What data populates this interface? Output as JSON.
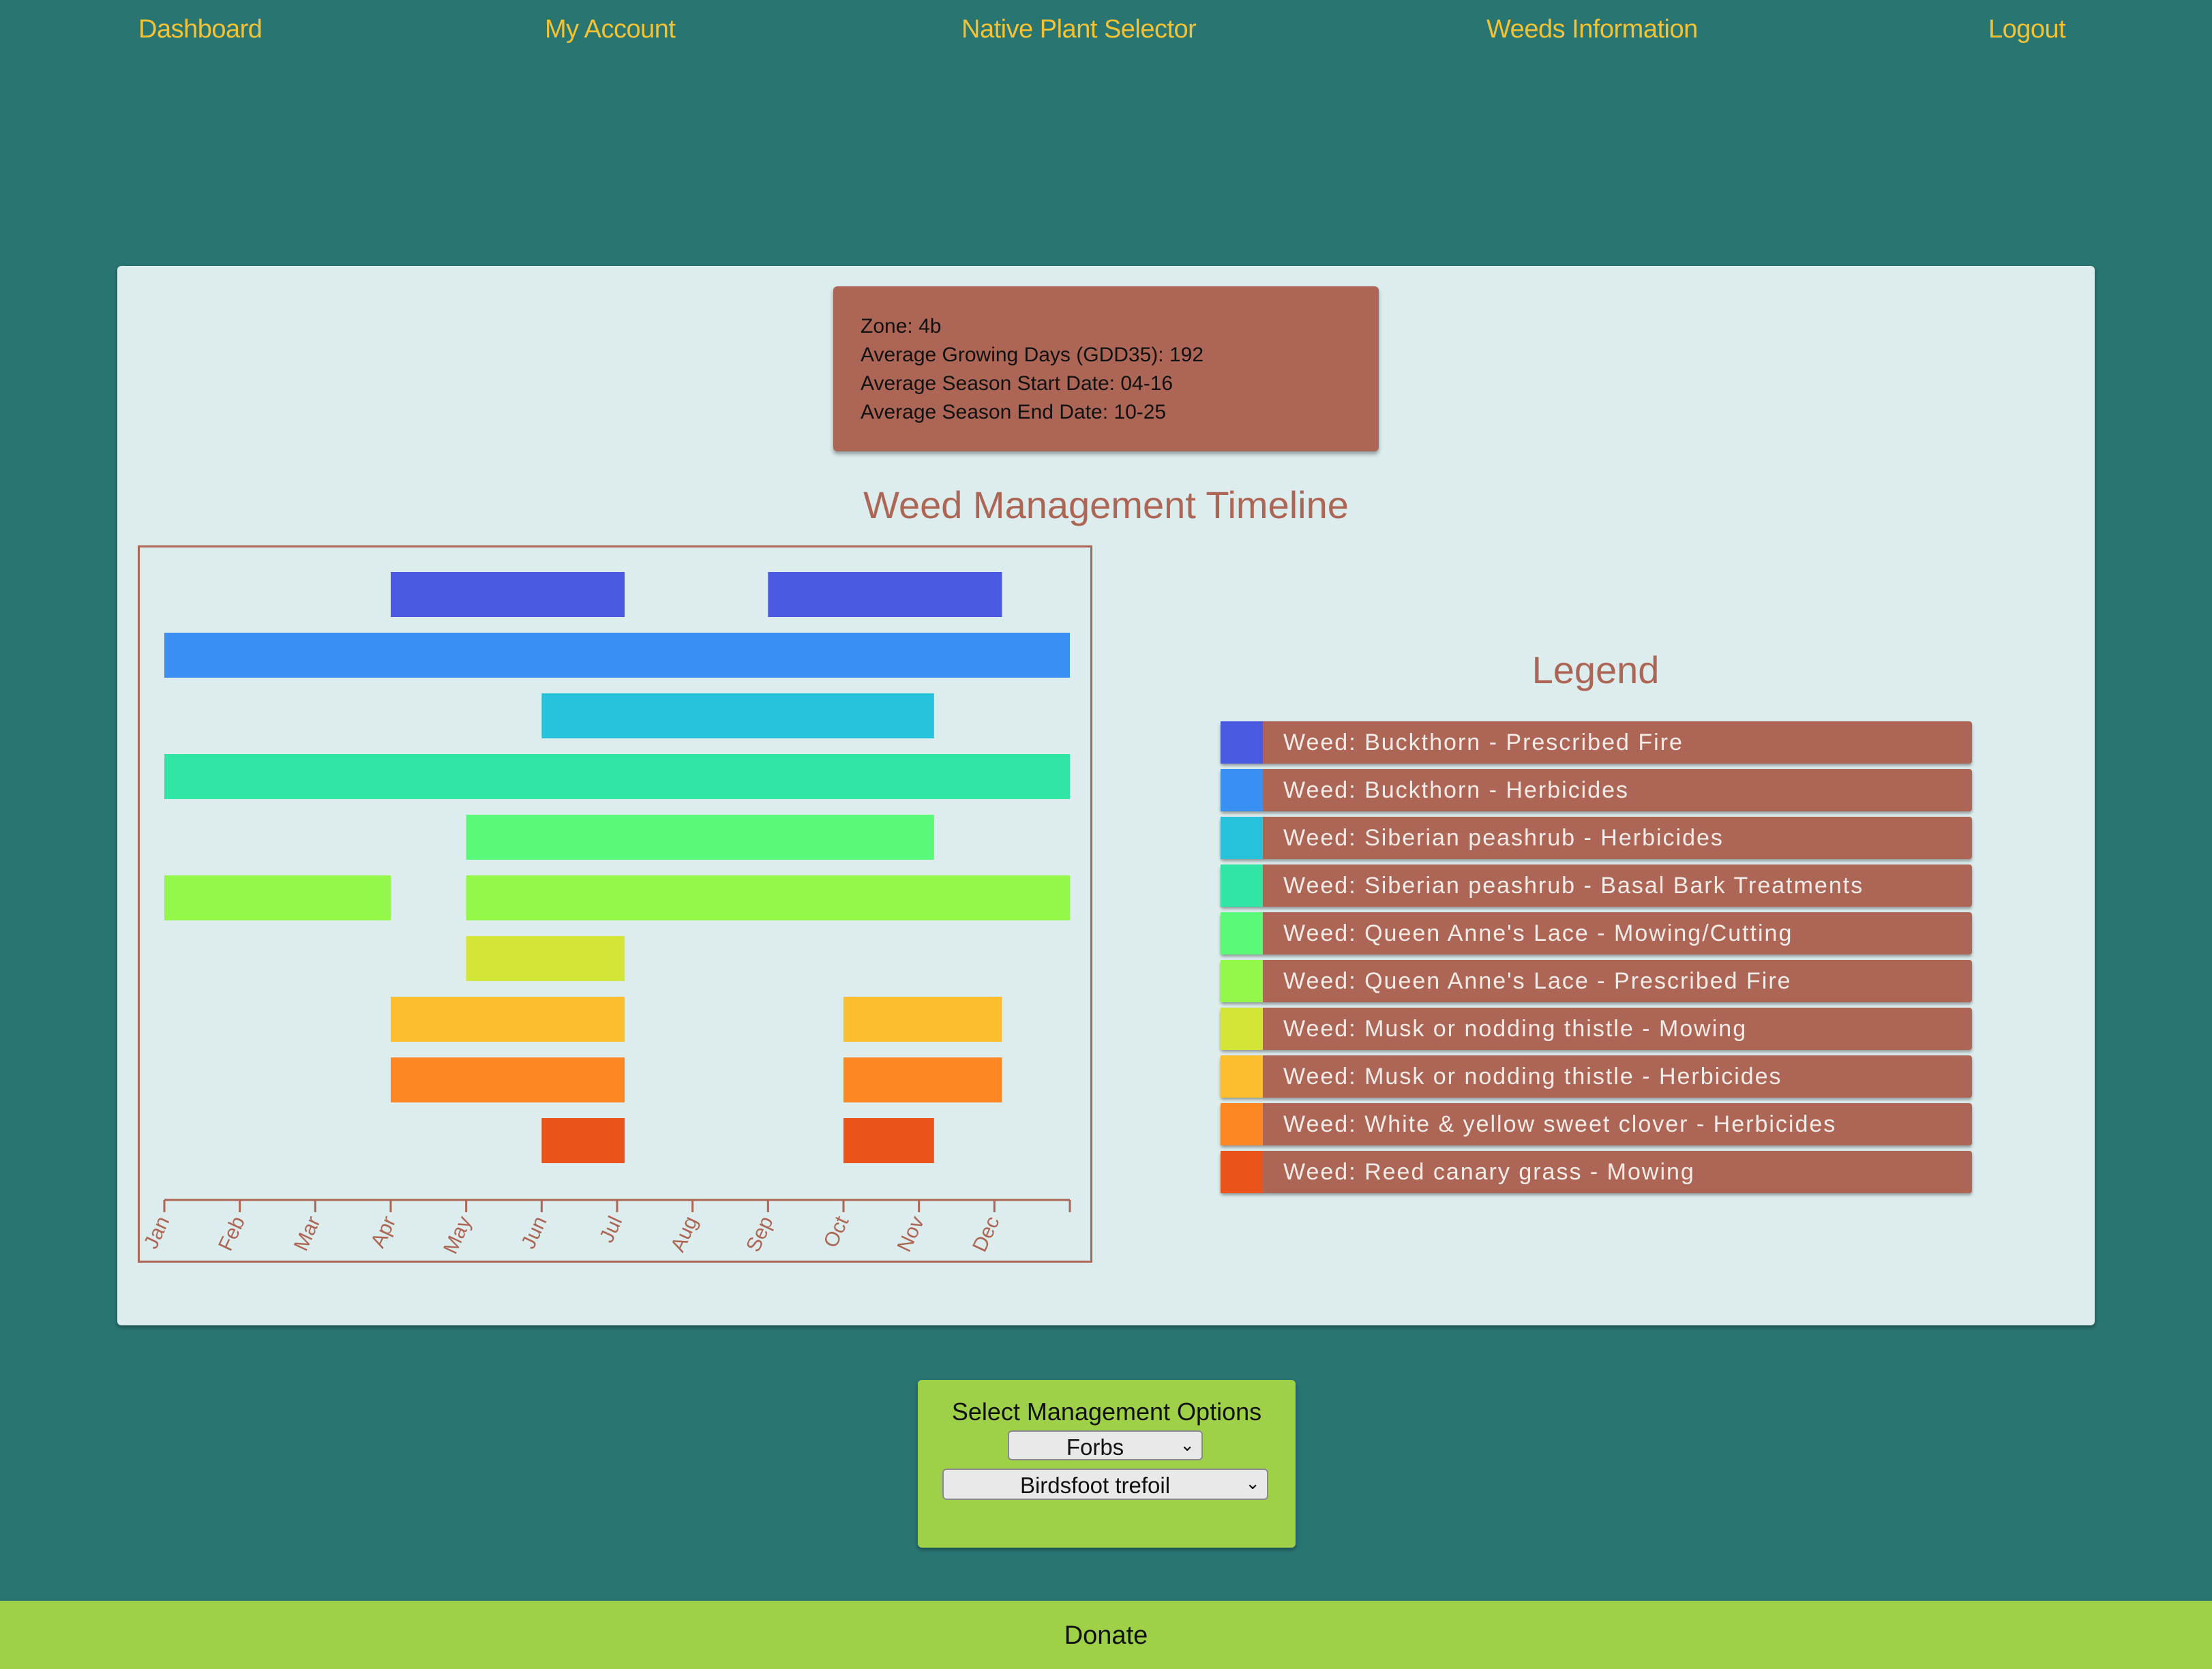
{
  "nav": {
    "dashboard": "Dashboard",
    "my_account": "My Account",
    "native_plant_selector": "Native Plant Selector",
    "weeds_information": "Weeds Information",
    "logout": "Logout"
  },
  "zone_info": {
    "zone_label": "Zone:",
    "zone_value": "4b",
    "gdd_label": "Average Growing Days (GDD35):",
    "gdd_value": "192",
    "start_label": "Average Season Start Date:",
    "start_value": "04-16",
    "end_label": "Average Season End Date:",
    "end_value": "10-25"
  },
  "timeline_title": "Weed Management Timeline",
  "legend_title": "Legend",
  "chart_data": {
    "type": "bar",
    "orientation": "horizontal-timeline",
    "months": [
      "Jan",
      "Feb",
      "Mar",
      "Apr",
      "May",
      "Jun",
      "Jul",
      "Aug",
      "Sep",
      "Oct",
      "Nov",
      "Dec"
    ],
    "series": [
      {
        "name": "Weed: Buckthorn - Prescribed Fire",
        "color": "#4a5ae0",
        "ranges": [
          [
            3.0,
            6.1
          ],
          [
            8.0,
            11.1
          ]
        ]
      },
      {
        "name": "Weed: Buckthorn - Herbicides",
        "color": "#3a8ff2",
        "ranges": [
          [
            0.0,
            12.0
          ]
        ]
      },
      {
        "name": "Weed: Siberian peashrub - Herbicides",
        "color": "#26c2db",
        "ranges": [
          [
            5.0,
            10.2
          ]
        ]
      },
      {
        "name": "Weed: Siberian peashrub - Basal Bark Treatments",
        "color": "#30e6a4",
        "ranges": [
          [
            0.0,
            12.0
          ]
        ]
      },
      {
        "name": "Weed: Queen Anne's Lace - Mowing/Cutting",
        "color": "#5afa78",
        "ranges": [
          [
            4.0,
            10.2
          ]
        ]
      },
      {
        "name": "Weed: Queen Anne's Lace - Prescribed Fire",
        "color": "#93f84a",
        "ranges": [
          [
            0.0,
            3.0
          ],
          [
            4.0,
            12.0
          ]
        ]
      },
      {
        "name": "Weed: Musk or nodding thistle - Mowing",
        "color": "#d3e638",
        "ranges": [
          [
            4.0,
            6.1
          ]
        ]
      },
      {
        "name": "Weed: Musk or nodding thistle - Herbicides",
        "color": "#fcbd2e",
        "ranges": [
          [
            3.0,
            6.1
          ],
          [
            9.0,
            11.1
          ]
        ]
      },
      {
        "name": "Weed: White & yellow sweet clover - Herbicides",
        "color": "#fd8823",
        "ranges": [
          [
            3.0,
            6.1
          ],
          [
            9.0,
            11.1
          ]
        ]
      },
      {
        "name": "Weed: Reed canary grass - Mowing",
        "color": "#ea531a",
        "ranges": [
          [
            5.0,
            6.1
          ],
          [
            9.0,
            10.2
          ]
        ]
      }
    ],
    "axis_color": "#ad6655"
  },
  "options": {
    "title": "Select Management Options",
    "category_value": "Forbs",
    "plant_value": "Birdsfoot trefoil"
  },
  "footer": {
    "donate": "Donate"
  }
}
